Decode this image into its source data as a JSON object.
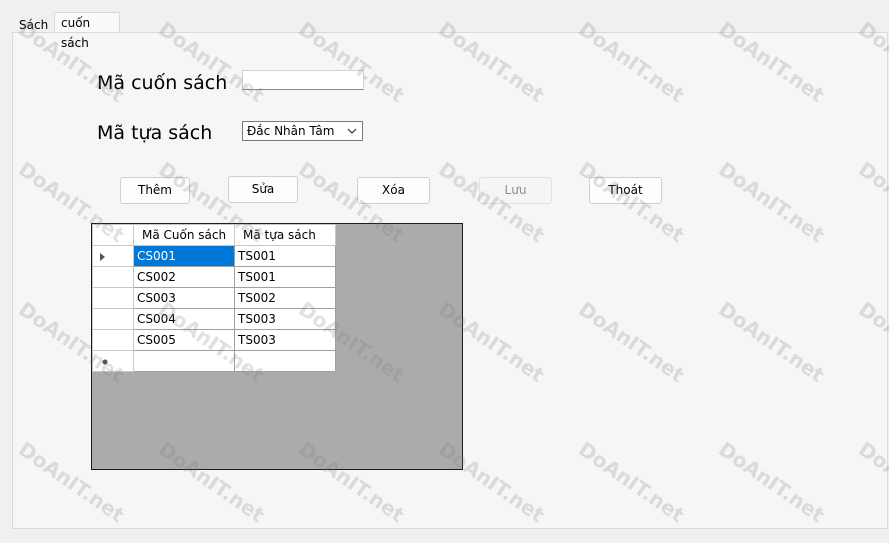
{
  "tabs": [
    {
      "label": "Sách",
      "active": false
    },
    {
      "label": "cuốn sách",
      "active": true
    }
  ],
  "form": {
    "ma_cuon_sach_label": "Mã cuốn sách",
    "ma_cuon_sach_value": "",
    "ma_tua_sach_label": "Mã tựa sách",
    "ma_tua_sach_selected": "Đắc Nhân Tâm"
  },
  "buttons": {
    "them": "Thêm",
    "sua": "Sửa",
    "xoa": "Xóa",
    "luu": "Lưu",
    "thoat": "Thoát"
  },
  "grid": {
    "columns": [
      "Mã Cuốn sách",
      "Mã tựa sách"
    ],
    "rows": [
      [
        "CS001",
        "TS001"
      ],
      [
        "CS002",
        "TS001"
      ],
      [
        "CS003",
        "TS002"
      ],
      [
        "CS004",
        "TS003"
      ],
      [
        "CS005",
        "TS003"
      ]
    ],
    "selected_row": 0
  },
  "watermark": "DoAnIT.net",
  "colors": {
    "selection": "#0078d7",
    "grid_background": "#ababab",
    "panel_background": "#f6f6f6"
  }
}
